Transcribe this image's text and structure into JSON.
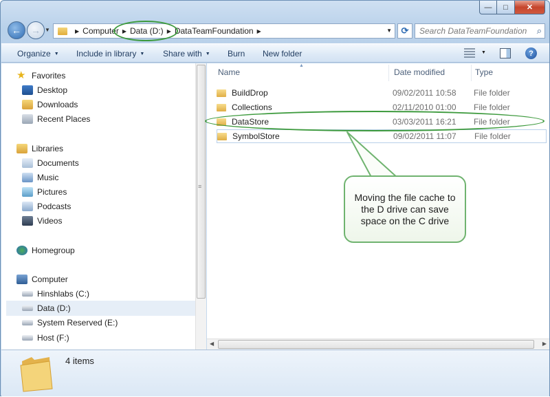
{
  "caption": {
    "minimize": "—",
    "maximize": "□",
    "close": "✕"
  },
  "address": {
    "segments": [
      "Computer",
      "Data (D:)",
      "DataTeamFoundation"
    ],
    "search_placeholder": "Search DataTeamFoundation"
  },
  "toolbar": {
    "organize": "Organize",
    "include_in_library": "Include in library",
    "share_with": "Share with",
    "burn": "Burn",
    "new_folder": "New folder"
  },
  "sidebar": {
    "favorites": {
      "label": "Favorites",
      "items": [
        "Desktop",
        "Downloads",
        "Recent Places"
      ]
    },
    "libraries": {
      "label": "Libraries",
      "items": [
        "Documents",
        "Music",
        "Pictures",
        "Podcasts",
        "Videos"
      ]
    },
    "homegroup": {
      "label": "Homegroup"
    },
    "computer": {
      "label": "Computer",
      "items": [
        "Hinshlabs (C:)",
        "Data (D:)",
        "System Reserved (E:)",
        "Host (F:)"
      ]
    }
  },
  "file_list": {
    "columns": [
      "Name",
      "Date modified",
      "Type"
    ],
    "rows": [
      {
        "name": "BuildDrop",
        "date": "09/02/2011 10:58",
        "type": "File folder"
      },
      {
        "name": "Collections",
        "date": "02/11/2010 01:00",
        "type": "File folder"
      },
      {
        "name": "DataStore",
        "date": "03/03/2011 16:21",
        "type": "File folder"
      },
      {
        "name": "SymbolStore",
        "date": "09/02/2011 11:07",
        "type": "File folder"
      }
    ]
  },
  "callout": {
    "text": "Moving the file cache to the D drive can save space on the C drive"
  },
  "details": {
    "items_count": "4 items"
  },
  "colors": {
    "highlight_green": "#3d9a3d",
    "window_frame": "#b9d1ea"
  }
}
